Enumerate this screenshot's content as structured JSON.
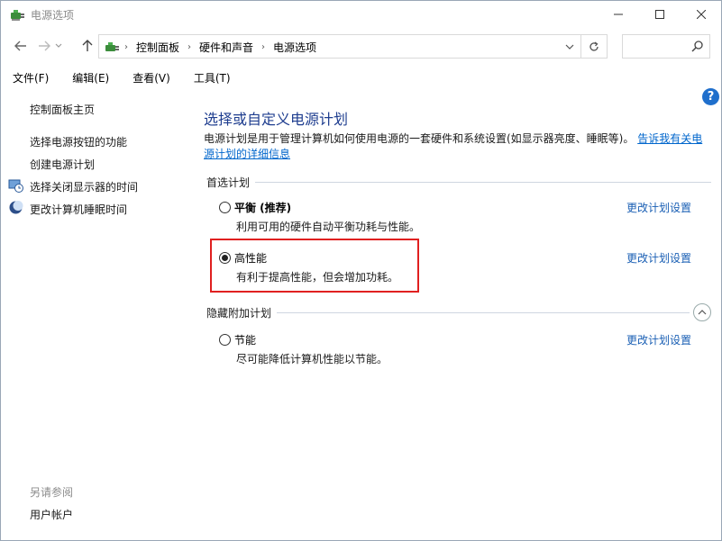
{
  "window": {
    "title": "电源选项",
    "icon": "power-options-icon"
  },
  "address": {
    "crumbs": [
      "控制面板",
      "硬件和声音",
      "电源选项"
    ],
    "search_placeholder": ""
  },
  "menu": [
    "文件(F)",
    "编辑(E)",
    "查看(V)",
    "工具(T)"
  ],
  "sidebar": {
    "home": "控制面板主页",
    "links": [
      "选择电源按钮的功能",
      "创建电源计划",
      "选择关闭显示器的时间",
      "更改计算机睡眠时间"
    ],
    "see_also": "另请参阅",
    "user_accounts": "用户帐户"
  },
  "main": {
    "title": "选择或自定义电源计划",
    "description": "电源计划是用于管理计算机如何使用电源的一套硬件和系统设置(如显示器亮度、睡眠等)。",
    "description_link": "告诉我有关电源计划的详细信息",
    "preferred_label": "首选计划",
    "hidden_label": "隐藏附加计划",
    "plans": [
      {
        "name": "平衡 (推荐)",
        "desc": "利用可用的硬件自动平衡功耗与性能。",
        "link": "更改计划设置",
        "selected": false
      },
      {
        "name": "高性能",
        "desc": "有利于提高性能，但会增加功耗。",
        "link": "更改计划设置",
        "selected": true
      },
      {
        "name": "节能",
        "desc": "尽可能降低计算机性能以节能。",
        "link": "更改计划设置",
        "selected": false
      }
    ]
  },
  "colors": {
    "title_blue": "#1e3d8f",
    "link_blue": "#1a5fb4",
    "highlight_red": "#e02020"
  }
}
